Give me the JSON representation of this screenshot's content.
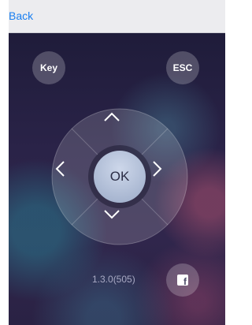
{
  "header": {
    "back_label": "Back"
  },
  "controls": {
    "key_label": "Key",
    "esc_label": "ESC",
    "ok_label": "OK"
  },
  "footer": {
    "version": "1.3.0(505)",
    "share_icon": "facebook-icon",
    "share_glyph": "f"
  },
  "colors": {
    "link": "#1a7ff0",
    "header_bg": "#ececef",
    "background_dark": "#2a2348",
    "ok_button": "#aab8d2"
  }
}
